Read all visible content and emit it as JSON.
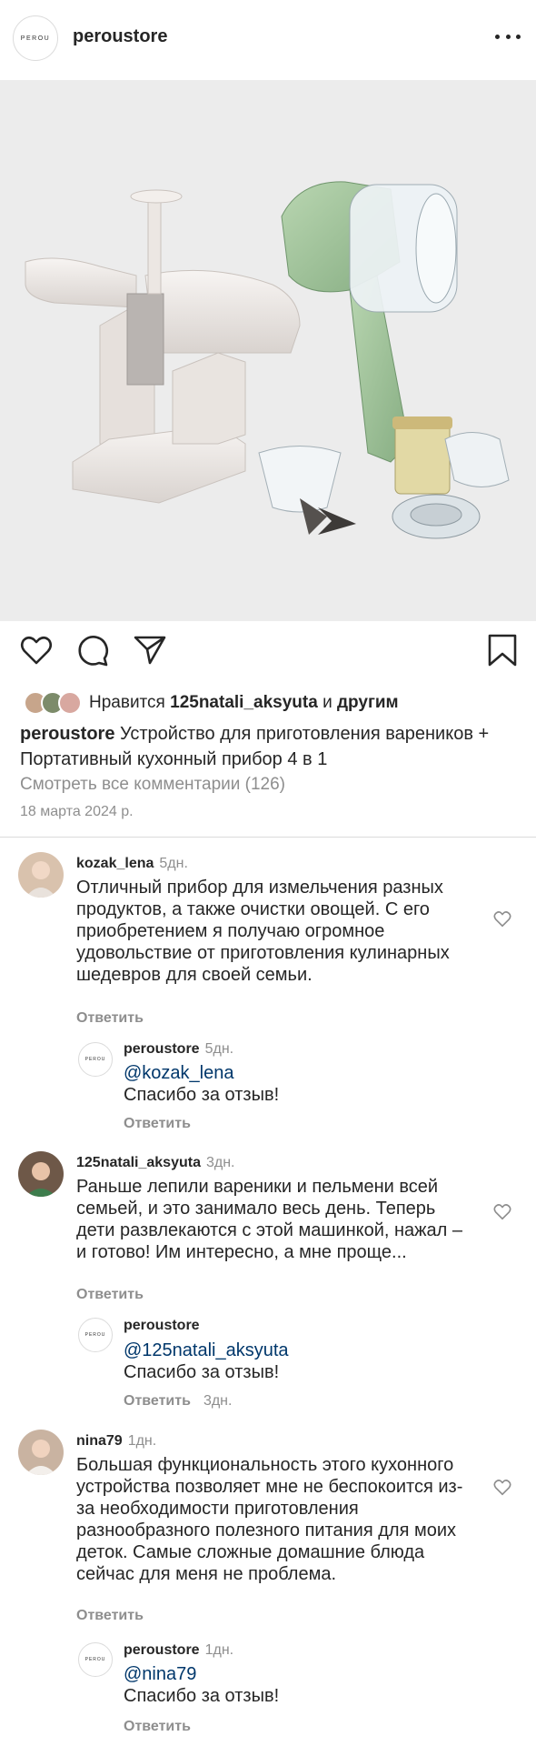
{
  "header": {
    "logo_text": "PEROU",
    "username": "peroustore",
    "menu_icon": "more-horizontal-icon"
  },
  "post": {
    "image_alt": "dumpling maker and 4-in-1 portable kitchen chopper",
    "actions": {
      "like_icon": "heart-icon",
      "comment_icon": "comment-icon",
      "share_icon": "send-icon",
      "save_icon": "bookmark-icon"
    },
    "likes": {
      "prefix": "Нравится",
      "user": "125natali_aksyuta",
      "connector": "и",
      "others": "другим"
    },
    "caption": {
      "username": "peroustore",
      "text": "Устройство для приготовления вареников + Портативный кухонный прибор 4 в 1"
    },
    "view_all_comments": "Смотреть все комментарии (126)",
    "date": "18 марта 2024 р."
  },
  "comments": [
    {
      "username": "kozak_lena",
      "time": "5дн.",
      "text": "Отличный прибор для измельчения разных продуктов, а также очистки овощей. С его приобретением я получаю огромное удовольствие от приготовления кулинарных шедевров для своей семьи.",
      "reply_label": "Ответить",
      "reply": {
        "username": "peroustore",
        "time": "5дн.",
        "mention": "@kozak_lena",
        "text": "Спасибо за отзыв!",
        "reply_label": "Ответить",
        "reply_time": ""
      }
    },
    {
      "username": "125natali_aksyuta",
      "time": "3дн.",
      "text": "Раньше лепили вареники и пельмени всей семьей, и это занимало весь день. Теперь дети развлекаются с этой машинкой, нажал – и готово! Им интересно, а мне проще...",
      "reply_label": "Ответить",
      "reply": {
        "username": "peroustore",
        "time": "",
        "mention": "@125natali_aksyuta",
        "text": "Спасибо за отзыв!",
        "reply_label": "Ответить",
        "reply_time": "3дн."
      }
    },
    {
      "username": "nina79",
      "time": "1дн.",
      "text": "Большая функциональность этого кухонного устройства позволяет мне не беспокоится из-за необходимости приготовления разнообразного полезного питания для моих деток. Самые сложные домашние блюда сейчас для меня не проблема.",
      "reply_label": "Ответить",
      "reply": {
        "username": "peroustore",
        "time": "1дн.",
        "mention": "@nina79",
        "text": "Спасибо за отзыв!",
        "reply_label": "Ответить",
        "reply_time": ""
      }
    }
  ],
  "colors": {
    "text": "#262626",
    "secondary": "#8e8e8e",
    "mention": "#00376b",
    "photo_bg": "#ececec",
    "device_green": "#9fc49a"
  }
}
